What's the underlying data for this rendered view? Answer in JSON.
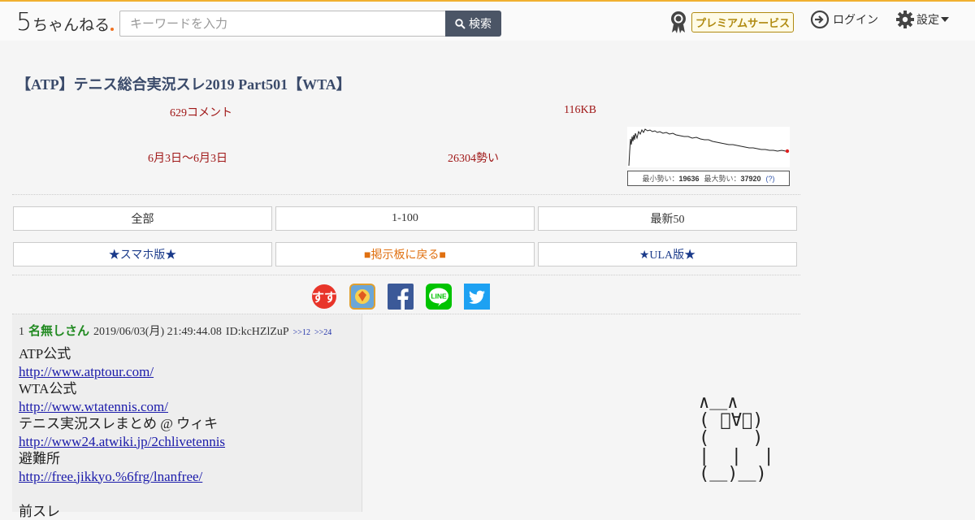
{
  "header": {
    "logo_digit": "5",
    "logo_text": "ちゃんねる",
    "search_placeholder": "キーワードを入力",
    "search_button": "検索",
    "premium_label": "プレミアムサービス",
    "login_label": "ログイン",
    "settings_label": "設定"
  },
  "thread": {
    "title": "【ATP】テニス総合実況スレ2019 Part501【WTA】",
    "comments": "629コメント",
    "size": "116KB",
    "dates": "6月3日〜6月3日",
    "momentum": "26304勢い",
    "graph": {
      "min_label": "最小勢い：",
      "min_value": "19636",
      "max_label": "最大勢い：",
      "max_value": "37920",
      "help": "(?)"
    }
  },
  "nav": {
    "all": "全部",
    "range": "1-100",
    "latest": "最新50",
    "smartphone": "★スマホ版★",
    "back": "■掲示板に戻る■",
    "ula": "★ULA版★"
  },
  "social": [
    "sumasu-icon",
    "bookmark-icon",
    "facebook-icon",
    "line-icon",
    "twitter-icon"
  ],
  "social_labels": {
    "line": "LINE"
  },
  "post": {
    "number": "1",
    "name": "名無しさん",
    "date": "2019/06/03(月) 21:49:44.08",
    "id": "ID:kcHZlZuP",
    "refs": [
      ">>12",
      ">>24"
    ],
    "lines": [
      {
        "text": "ATP公式"
      },
      {
        "link": "http://www.atptour.com/"
      },
      {
        "text": "WTA公式"
      },
      {
        "link": "http://www.wtatennis.com/"
      },
      {
        "text": "テニス実況スレまとめ @ ウィキ"
      },
      {
        "link": "http://www24.atwiki.jp/2chlivetennis"
      },
      {
        "text": "避難所"
      },
      {
        "link": "http://free.jikkyo.%6frg/lnanfree/"
      },
      {
        "text": ""
      },
      {
        "text": "前スレ"
      }
    ]
  },
  "ascii_art": "∧＿∧\n( ﾟ∀ﾟ)\n(    )\n|  |  |\n(＿)＿)",
  "colors": {
    "accent": "#f0b030",
    "meta_red": "#a01818",
    "name_green": "#218a21",
    "facebook": "#3b5998",
    "line": "#00c300",
    "twitter": "#1da1f2"
  }
}
